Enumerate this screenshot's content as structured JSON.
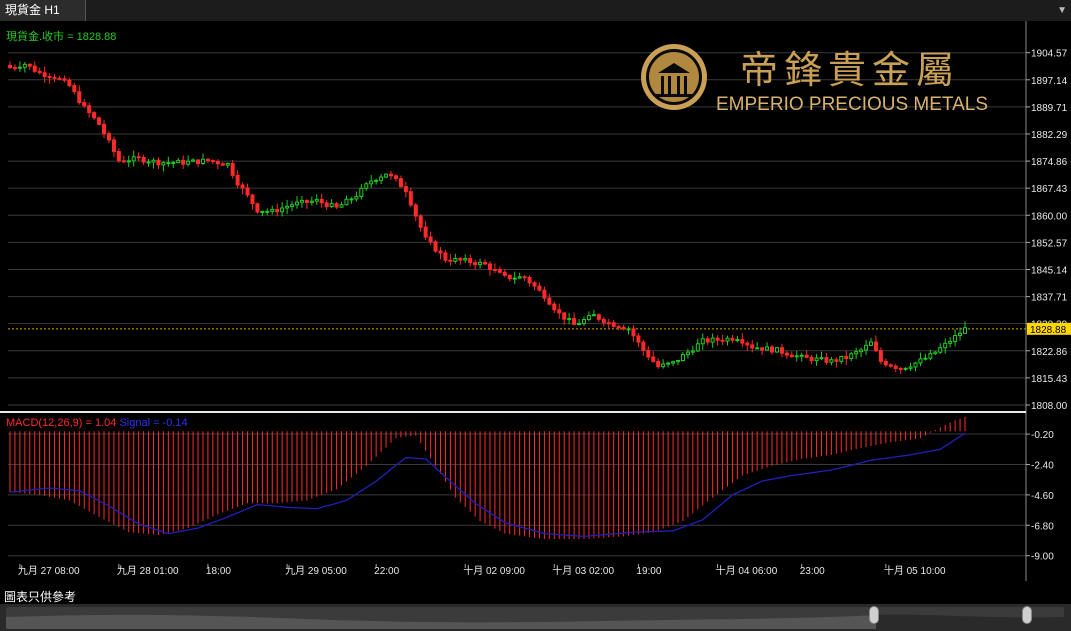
{
  "tab": {
    "label": "現貨金 H1",
    "arrow": "▼"
  },
  "header": {
    "close_label": "收市",
    "close_value": "1828.88",
    "symbol": "現貨金"
  },
  "logo": {
    "chinese": "帝鋒貴金屬",
    "english": "EMPERIO PRECIOUS METALS"
  },
  "macd": {
    "label": "MACD(12,26,9) = 1.04",
    "signal_label": "Signal = -0.14"
  },
  "footer_note": "圖表只供參考",
  "colors": {
    "bull": "#22cc22",
    "bear": "#ff2a2a",
    "signal": "#2020bb",
    "grid": "#3a3a3a",
    "axis_text": "#e8e8e8",
    "price_tag": "#ffd700"
  },
  "chart_data": [
    {
      "type": "candlestick",
      "title": "現貨金 H1",
      "ylim": [
        1808.0,
        1907.5
      ],
      "y_ticks": [
        "1904.57",
        "1897.14",
        "1889.71",
        "1882.29",
        "1874.86",
        "1867.43",
        "1860.00",
        "1852.57",
        "1845.14",
        "1837.71",
        "1830.29",
        "1822.86",
        "1815.43",
        "1808.00"
      ],
      "current_price": "1828.88",
      "x_labels": [
        "九月 27 08:00",
        "九月 28 01:00",
        "18:00",
        "九月 29 05:00",
        "22:00",
        "十月 02 09:00",
        "十月 03 02:00",
        "19:00",
        "十月 04 06:00",
        "23:00",
        "十月 05 10:00"
      ],
      "close_anchors": [
        [
          0,
          1900.5
        ],
        [
          3,
          1901.5
        ],
        [
          6,
          1899.0
        ],
        [
          9,
          1898.0
        ],
        [
          12,
          1895.5
        ],
        [
          15,
          1889.5
        ],
        [
          18,
          1885.0
        ],
        [
          22,
          1875.0
        ],
        [
          26,
          1875.5
        ],
        [
          30,
          1874.5
        ],
        [
          35,
          1874.5
        ],
        [
          40,
          1875.0
        ],
        [
          44,
          1874.0
        ],
        [
          46,
          1869.0
        ],
        [
          50,
          1861.5
        ],
        [
          53,
          1861.0
        ],
        [
          57,
          1863.0
        ],
        [
          62,
          1864.0
        ],
        [
          66,
          1862.0
        ],
        [
          70,
          1865.5
        ],
        [
          73,
          1869.5
        ],
        [
          76,
          1871.5
        ],
        [
          78,
          1869.5
        ],
        [
          80,
          1867.0
        ],
        [
          82,
          1860.0
        ],
        [
          84,
          1853.5
        ],
        [
          88,
          1848.0
        ],
        [
          92,
          1847.5
        ],
        [
          96,
          1846.5
        ],
        [
          100,
          1843.0
        ],
        [
          104,
          1843.0
        ],
        [
          108,
          1838.0
        ],
        [
          111,
          1833.0
        ],
        [
          114,
          1830.0
        ],
        [
          118,
          1832.5
        ],
        [
          121,
          1830.5
        ],
        [
          125,
          1829.0
        ],
        [
          128,
          1823.0
        ],
        [
          131,
          1818.5
        ],
        [
          134,
          1819.5
        ],
        [
          137,
          1822.5
        ],
        [
          140,
          1825.5
        ],
        [
          144,
          1826.0
        ],
        [
          147,
          1826.5
        ],
        [
          150,
          1824.0
        ],
        [
          155,
          1823.0
        ],
        [
          160,
          1821.0
        ],
        [
          163,
          1820.5
        ],
        [
          166,
          1820.0
        ],
        [
          169,
          1821.0
        ],
        [
          172,
          1823.0
        ],
        [
          174,
          1825.0
        ],
        [
          176,
          1820.0
        ],
        [
          180,
          1818.0
        ],
        [
          183,
          1819.5
        ],
        [
          186,
          1821.5
        ],
        [
          189,
          1824.5
        ],
        [
          193,
          1828.88
        ]
      ],
      "macd_ylim": [
        -9.6,
        0.6
      ],
      "macd_ticks": [
        "-0.20",
        "-2.40",
        "-4.60",
        "-6.80",
        "-9.00"
      ],
      "macd_hist_anchors": [
        [
          0,
          -4.4
        ],
        [
          6,
          -4.6
        ],
        [
          12,
          -5.0
        ],
        [
          18,
          -6.2
        ],
        [
          24,
          -7.3
        ],
        [
          30,
          -7.5
        ],
        [
          36,
          -7.0
        ],
        [
          42,
          -6.0
        ],
        [
          48,
          -5.2
        ],
        [
          54,
          -5.2
        ],
        [
          60,
          -5.0
        ],
        [
          66,
          -4.2
        ],
        [
          72,
          -2.5
        ],
        [
          78,
          -0.5
        ],
        [
          82,
          -0.3
        ],
        [
          86,
          -2.5
        ],
        [
          90,
          -4.8
        ],
        [
          95,
          -6.5
        ],
        [
          100,
          -7.4
        ],
        [
          108,
          -7.8
        ],
        [
          116,
          -7.8
        ],
        [
          124,
          -7.6
        ],
        [
          130,
          -7.3
        ],
        [
          136,
          -6.5
        ],
        [
          142,
          -4.8
        ],
        [
          148,
          -3.2
        ],
        [
          154,
          -2.5
        ],
        [
          160,
          -2.0
        ],
        [
          166,
          -1.7
        ],
        [
          172,
          -1.2
        ],
        [
          178,
          -0.8
        ],
        [
          184,
          -0.5
        ],
        [
          188,
          0.3
        ],
        [
          191,
          0.8
        ],
        [
          193,
          1.04
        ]
      ],
      "macd_signal_anchors": [
        [
          0,
          -4.4
        ],
        [
          8,
          -4.1
        ],
        [
          14,
          -4.3
        ],
        [
          20,
          -5.4
        ],
        [
          26,
          -6.7
        ],
        [
          32,
          -7.4
        ],
        [
          38,
          -7.0
        ],
        [
          44,
          -6.2
        ],
        [
          50,
          -5.3
        ],
        [
          56,
          -5.5
        ],
        [
          62,
          -5.6
        ],
        [
          68,
          -5.0
        ],
        [
          74,
          -3.6
        ],
        [
          80,
          -1.9
        ],
        [
          84,
          -2.0
        ],
        [
          88,
          -3.3
        ],
        [
          94,
          -5.2
        ],
        [
          100,
          -6.6
        ],
        [
          108,
          -7.4
        ],
        [
          116,
          -7.6
        ],
        [
          126,
          -7.3
        ],
        [
          134,
          -7.2
        ],
        [
          140,
          -6.4
        ],
        [
          146,
          -4.6
        ],
        [
          152,
          -3.6
        ],
        [
          158,
          -3.2
        ],
        [
          166,
          -2.8
        ],
        [
          174,
          -2.1
        ],
        [
          182,
          -1.7
        ],
        [
          188,
          -1.3
        ],
        [
          193,
          -0.14
        ]
      ]
    }
  ]
}
